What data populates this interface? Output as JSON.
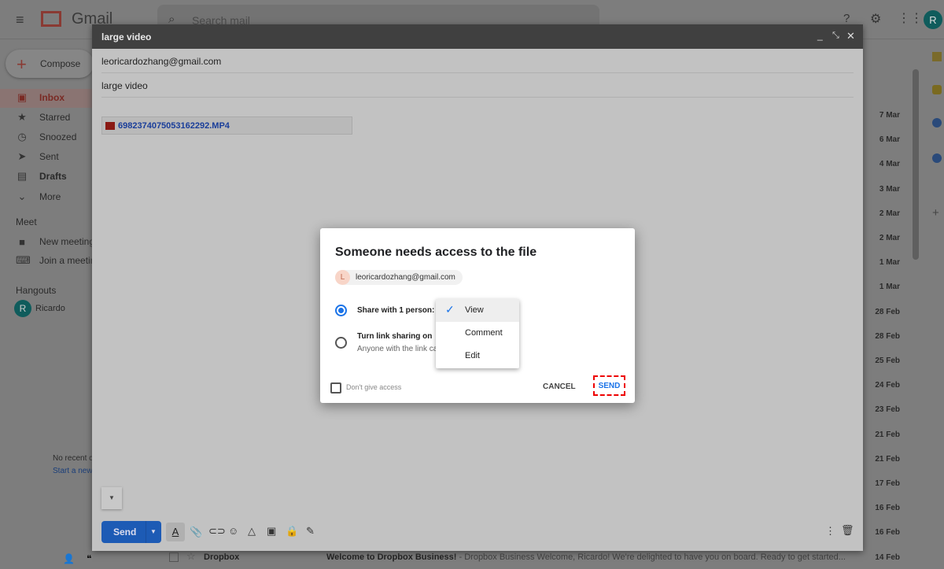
{
  "app": {
    "name": "Gmail",
    "search_placeholder": "Search mail",
    "compose": "Compose",
    "avatar": "R"
  },
  "sidebar": {
    "items": [
      {
        "label": "Inbox",
        "icon": "inbox-icon"
      },
      {
        "label": "Starred",
        "icon": "star-icon"
      },
      {
        "label": "Snoozed",
        "icon": "clock-icon"
      },
      {
        "label": "Sent",
        "icon": "send-icon"
      },
      {
        "label": "Drafts",
        "icon": "draft-icon"
      },
      {
        "label": "More",
        "icon": "chevron-down-icon"
      }
    ],
    "meet_title": "Meet",
    "meet": [
      "New meeting",
      "Join a meeting"
    ],
    "hangouts_title": "Hangouts",
    "hangouts_user": "Ricardo",
    "no_recent": "No recent chats",
    "start_new": "Start a new one"
  },
  "list": {
    "dates": [
      "7 Mar",
      "6 Mar",
      "4 Mar",
      "3 Mar",
      "2 Mar",
      "2 Mar",
      "1 Mar",
      "1 Mar",
      "28 Feb",
      "28 Feb",
      "25 Feb",
      "24 Feb",
      "23 Feb",
      "21 Feb",
      "21 Feb",
      "17 Feb",
      "16 Feb",
      "16 Feb",
      "14 Feb"
    ],
    "last_row": {
      "sender": "Dropbox",
      "subject": "Welcome to Dropbox Business!",
      "snippet": " - Dropbox Business Welcome, Ricardo! We're delighted to have you on board. Ready to get started..."
    }
  },
  "compose": {
    "title": "large video",
    "to": "leoricardozhang@gmail.com",
    "subject": "large video",
    "attachment": "6982374075053162292.MP4",
    "send": "Send"
  },
  "dialog": {
    "title": "Someone needs access to the file",
    "recipient": "leoricardozhang@gmail.com",
    "recipient_initial": "L",
    "option1": "Share with 1 person:",
    "option2": "Turn link sharing on",
    "option2_sub": "Anyone with the link can view",
    "menu": [
      "View",
      "Comment",
      "Edit"
    ],
    "selected": "View",
    "dont_give": "Don't give access",
    "cancel": "CANCEL",
    "send": "SEND",
    "accent": "#1a73e8"
  }
}
